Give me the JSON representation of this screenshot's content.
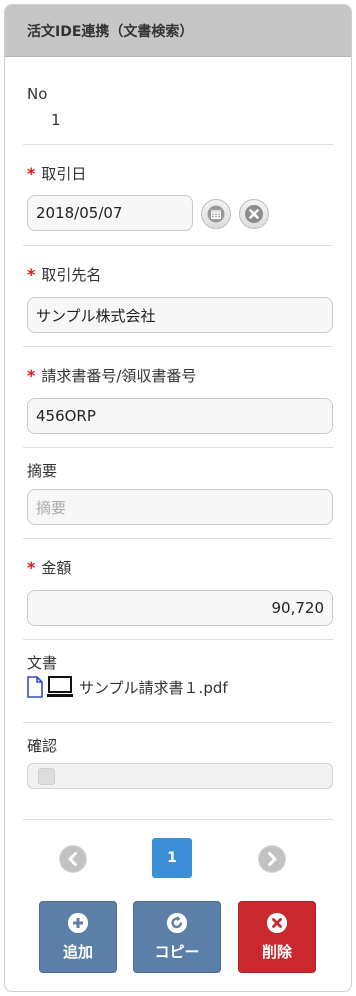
{
  "header": {
    "title": "活文IDE連携（文書検索）"
  },
  "form": {
    "no": {
      "label": "No",
      "value": "1"
    },
    "date": {
      "label": "取引日",
      "value": "2018/05/07"
    },
    "partner": {
      "label": "取引先名",
      "value": "サンプル株式会社"
    },
    "invoice": {
      "label": "請求書番号/領収書番号",
      "value": "456ORP"
    },
    "summary": {
      "label": "摘要",
      "placeholder": "摘要",
      "value": ""
    },
    "amount": {
      "label": "金額",
      "value": "90,720"
    },
    "document": {
      "label": "文書",
      "file_name": "サンプル請求書１.pdf"
    },
    "confirm": {
      "label": "確認"
    }
  },
  "pager": {
    "current_page": "1"
  },
  "actions": {
    "add_label": "追加",
    "copy_label": "コピー",
    "delete_label": "削除"
  },
  "colors": {
    "accent": "#3c8fd6",
    "required": "#d11a1a",
    "action_blue": "#5a7ea8",
    "delete_red": "#c9282d"
  }
}
